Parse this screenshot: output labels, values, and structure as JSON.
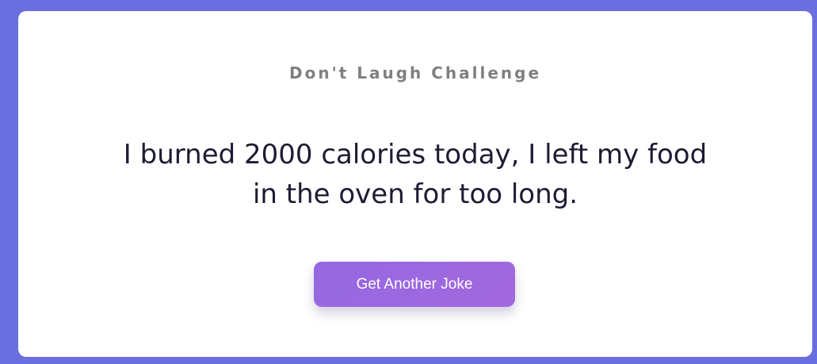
{
  "app": {
    "title": "Don't Laugh Challenge"
  },
  "joke": {
    "text": "I burned 2000 calories today, I left my food in the oven for too long."
  },
  "actions": {
    "next_label": "Get Another Joke"
  },
  "colors": {
    "background": "#6a6ede",
    "card": "#ffffff",
    "heading": "#808080",
    "joke_text": "#1e1b33",
    "button": "#9c68df",
    "button_text": "#ffffff"
  }
}
